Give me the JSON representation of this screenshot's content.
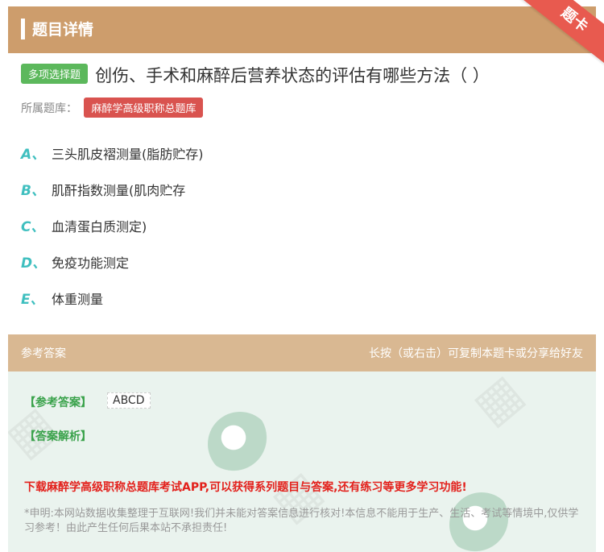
{
  "header": {
    "title": "题目详情",
    "ribbon": "题卡"
  },
  "question": {
    "type": "多项选择题",
    "text": "创伤、手术和麻醉后营养状态的评估有哪些方法（      ）",
    "library_label": "所属题库：",
    "library": "麻醉学高级职称总题库"
  },
  "options": [
    {
      "letter": "A、",
      "text": "三头肌皮褶测量(脂肪贮存)"
    },
    {
      "letter": "B、",
      "text": "肌酐指数测量(肌肉贮存"
    },
    {
      "letter": "C、",
      "text": "血清蛋白质测定)"
    },
    {
      "letter": "D、",
      "text": "免疫功能测定"
    },
    {
      "letter": "E、",
      "text": "体重测量"
    }
  ],
  "answer_section": {
    "title": "参考答案",
    "hint": "长按（或右击）可复制本题卡或分享给好友",
    "answer_label": "【参考答案】",
    "answer_value": "ABCD",
    "analysis_label": "【答案解析】",
    "promo": "下载麻醉学高级职称总题库考试APP,可以获得系列题目与答案,还有练习等更多学习功能!",
    "disclaimer": "*申明:本网站数据收集整理于互联网!我们并未能对答案信息进行核对!本信息不能用于生产、生活、考试等情境中,仅供学习参考！由此产生任何后果本站不承担责任!"
  },
  "colors": {
    "header": "#cd9d6c",
    "ribbon": "#e85a4f",
    "type_badge": "#5cb85c",
    "library_badge": "#d9534f",
    "option_letter": "#3fbfbf",
    "promo": "#e3211c"
  }
}
